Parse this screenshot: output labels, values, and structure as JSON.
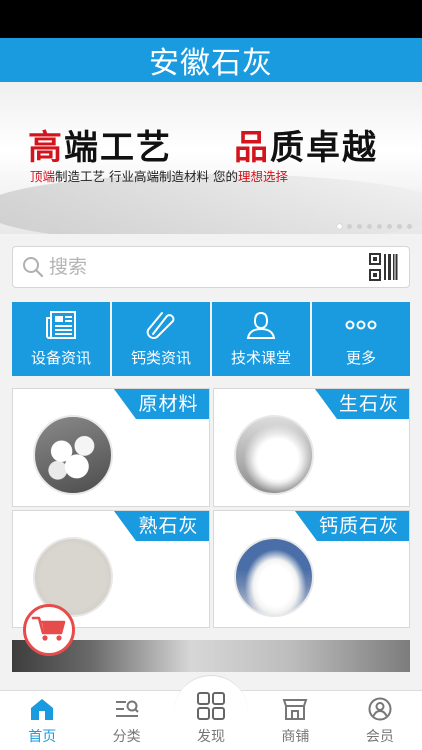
{
  "app": {
    "title": "安徽石灰"
  },
  "banner": {
    "headline_left_red": "高",
    "headline_left_rest": "端工艺",
    "headline_right_red": "品",
    "headline_right_rest": "质卓越",
    "subline_red_1": "顶端",
    "subline_black_1": "制造工艺 行业",
    "subline_black_2": "高端制造材料 您的",
    "subline_red_2": "理想选择",
    "slide_count": 8,
    "active_slide": 1
  },
  "search": {
    "placeholder": "搜索",
    "search_icon": "search-icon",
    "scan_icon": "qr-scan-icon"
  },
  "categories": [
    {
      "label": "设备资讯",
      "icon": "newspaper-icon"
    },
    {
      "label": "钙类资讯",
      "icon": "paperclip-icon"
    },
    {
      "label": "技术课堂",
      "icon": "user-icon"
    },
    {
      "label": "更多",
      "icon": "more-dots-icon"
    }
  ],
  "products": [
    {
      "label": "原材料"
    },
    {
      "label": "生石灰"
    },
    {
      "label": "熟石灰"
    },
    {
      "label": "钙质石灰"
    }
  ],
  "cart": {
    "icon": "cart-icon"
  },
  "tabs": [
    {
      "label": "首页",
      "icon": "home-icon",
      "active": true
    },
    {
      "label": "分类",
      "icon": "category-list-icon",
      "active": false
    },
    {
      "label": "发现",
      "icon": "grid-icon",
      "active": false
    },
    {
      "label": "商铺",
      "icon": "shop-icon",
      "active": false
    },
    {
      "label": "会员",
      "icon": "member-icon",
      "active": false
    }
  ],
  "colors": {
    "accent": "#1a9be0",
    "banner_red": "#d4141c",
    "cart_red": "#e74c4c"
  }
}
